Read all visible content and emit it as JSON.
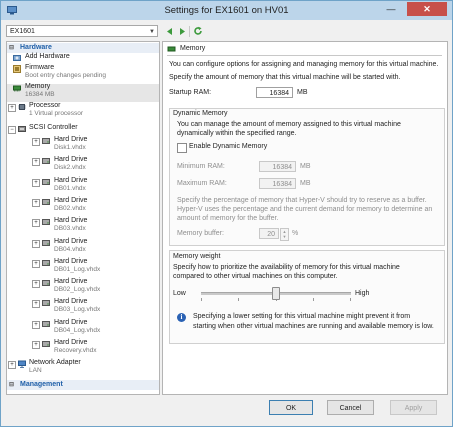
{
  "window": {
    "title": "Settings for EX1601 on HV01",
    "minimize_glyph": "—",
    "close_glyph": "✕"
  },
  "vm_selector": {
    "value": "EX1601"
  },
  "sections": {
    "hardware": "Hardware",
    "management": "Management"
  },
  "tree": {
    "add_hardware": "Add Hardware",
    "firmware": {
      "label": "Firmware",
      "sub": "Boot entry changes pending"
    },
    "memory": {
      "label": "Memory",
      "sub": "16384 MB"
    },
    "processor": {
      "label": "Processor",
      "sub": "1 Virtual processor"
    },
    "scsi": "SCSI Controller",
    "drives": [
      {
        "label": "Hard Drive",
        "sub": "Disk1.vhdx"
      },
      {
        "label": "Hard Drive",
        "sub": "Disk2.vhdx"
      },
      {
        "label": "Hard Drive",
        "sub": "DB01.vhdx"
      },
      {
        "label": "Hard Drive",
        "sub": "DB02.vhdx"
      },
      {
        "label": "Hard Drive",
        "sub": "DB03.vhdx"
      },
      {
        "label": "Hard Drive",
        "sub": "DB04.vhdx"
      },
      {
        "label": "Hard Drive",
        "sub": "DB01_Log.vhdx"
      },
      {
        "label": "Hard Drive",
        "sub": "DB02_Log.vhdx"
      },
      {
        "label": "Hard Drive",
        "sub": "DB03_Log.vhdx"
      },
      {
        "label": "Hard Drive",
        "sub": "DB04_Log.vhdx"
      },
      {
        "label": "Hard Drive",
        "sub": "Recovery.vhdx"
      }
    ],
    "network": {
      "label": "Network Adapter",
      "sub": "LAN"
    }
  },
  "memory_panel": {
    "heading": "Memory",
    "intro": "You can configure options for assigning and managing memory for this virtual machine.",
    "startup_desc": "Specify the amount of memory that this virtual machine will be started with.",
    "startup_label": "Startup RAM:",
    "startup_value": "16384",
    "unit_mb": "MB",
    "dynamic": {
      "title": "Dynamic Memory",
      "desc1": "You can manage the amount of memory assigned to this virtual machine",
      "desc2": "dynamically within the specified range.",
      "enable_label": "Enable Dynamic Memory",
      "enabled": false,
      "min_label": "Minimum RAM:",
      "min_value": "16384",
      "max_label": "Maximum RAM:",
      "max_value": "16384",
      "buffer_desc1": "Specify the percentage of memory that Hyper-V should try to reserve as a buffer.",
      "buffer_desc2": "Hyper-V uses the percentage and the current demand for memory to determine an",
      "buffer_desc3": "amount of memory for the buffer.",
      "buffer_label": "Memory buffer:",
      "buffer_value": "20",
      "unit_pct": "%"
    },
    "weight": {
      "title": "Memory weight",
      "desc1": "Specify how to prioritize the availability of memory for this virtual machine",
      "desc2": "compared to other virtual machines on this computer.",
      "low": "Low",
      "high": "High",
      "level": 0.5,
      "note1": "Specifying a lower setting for this virtual machine might prevent it from",
      "note2": "starting when other virtual machines are running and available memory is low."
    }
  },
  "buttons": {
    "ok": "OK",
    "cancel": "Cancel",
    "apply": "Apply"
  },
  "colors": {
    "accent": "#1f5fa8",
    "titlebar": "#bcd5ea",
    "close": "#c7504a",
    "info": "#2a62b4"
  },
  "icons": [
    "app-icon",
    "back-arrow-icon",
    "forward-arrow-icon",
    "refresh-icon",
    "add-hardware-icon",
    "firmware-icon",
    "memory-icon",
    "processor-icon",
    "scsi-controller-icon",
    "hard-drive-icon",
    "network-adapter-icon",
    "info-icon"
  ]
}
